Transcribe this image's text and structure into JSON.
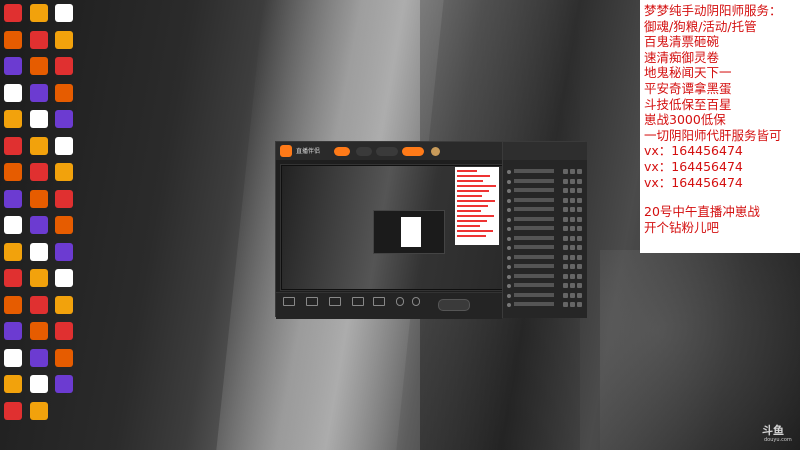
{
  "ad_panel": {
    "lines": [
      "梦梦纯手动阴阳师服务：",
      "御魂/狗粮/活动/托管",
      "百鬼清票砸碗",
      "速清痴御灵卷",
      "地鬼秘闻天下一",
      "平安奇谭拿黑蛋",
      "斗技低保至百星",
      "崽战3000低保",
      "一切阴阳师代肝服务皆可",
      "vx：164456474",
      "vx：164456474",
      "vx：164456474"
    ],
    "lines2": [
      "20号中午直播冲崽战",
      "开个钻粉儿吧"
    ],
    "text_color": "#d41010"
  },
  "watermark": {
    "brand": "斗鱼",
    "sub": "douyu.com"
  },
  "app": {
    "name": "直播伴侣",
    "accent": "#ff7a18"
  },
  "desktop": {
    "icon_colors": [
      "#e03030",
      "#3a8ee6",
      "#f2a20c",
      "#29a329",
      "#ffffff",
      "#cc2244",
      "#6c3bd1",
      "#1b9ad6",
      "#e65c00",
      "#4b4b4b"
    ]
  }
}
